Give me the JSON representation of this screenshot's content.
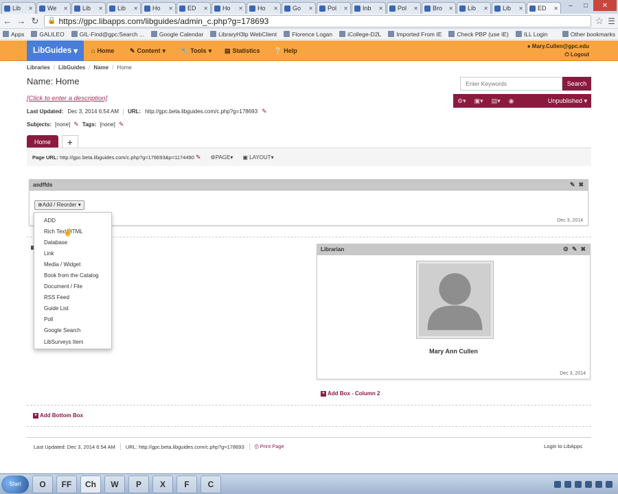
{
  "browser": {
    "tabs": [
      {
        "label": "Lib",
        "active": false
      },
      {
        "label": "We",
        "active": false
      },
      {
        "label": "Lib",
        "active": false
      },
      {
        "label": "Lib",
        "active": false
      },
      {
        "label": "Ho",
        "active": false
      },
      {
        "label": "ED",
        "active": false
      },
      {
        "label": "Ho",
        "active": false
      },
      {
        "label": "Ho",
        "active": false
      },
      {
        "label": "Go",
        "active": false
      },
      {
        "label": "Pol",
        "active": false
      },
      {
        "label": "Inb",
        "active": false
      },
      {
        "label": "Pol",
        "active": false
      },
      {
        "label": "Bro",
        "active": false
      },
      {
        "label": "Lib",
        "active": false
      },
      {
        "label": "Lib",
        "active": false
      },
      {
        "label": "ED",
        "active": true
      }
    ],
    "url": "https://gpc.libapps.com/libguides/admin_c.php?g=178693",
    "bookmarks": [
      "Apps",
      "GALILEO",
      "GIL-Find@gpc:Search ...",
      "Google Calendar",
      "LibraryH3lp WebClient",
      "Florence Logan",
      "iCollege-D2L",
      "Imported From IE",
      "Check PBP (use IE)",
      "ILL Login"
    ],
    "other_bookmarks": "Other bookmarks"
  },
  "libguides_nav": {
    "brand": "LibGuides",
    "items": [
      "Home",
      "Content",
      "Tools",
      "Statistics",
      "Help"
    ],
    "user_email": "Mary.Cullen@gpc.edu",
    "logout": "Logout"
  },
  "breadcrumb": [
    "Libraries",
    "LibGuides",
    "Name",
    "Home"
  ],
  "guide": {
    "title": "Name: Home",
    "description_prompt": "[Click to enter a description]",
    "last_updated_label": "Last Updated:",
    "last_updated": "Dec 3, 2014 6:54 AM",
    "url_label": "URL:",
    "url": "http://gpc.beta.libguides.com/c.php?g=178693",
    "subjects_label": "Subjects:",
    "subjects_value": "[none]",
    "tags_label": "Tags:",
    "tags_value": "[none]"
  },
  "search": {
    "placeholder": "Enter Keywords",
    "button": "Search"
  },
  "toolbar": {
    "unpublished": "Unpublished"
  },
  "page_tabs": {
    "home": "Home",
    "add": "+"
  },
  "page_url": {
    "label": "Page URL:",
    "value": "http://gpc.beta.libguides.com/c.php?g=178693&p=1174490",
    "page_btn": "PAGE",
    "layout_btn": "LAYOUT"
  },
  "box1": {
    "title": "asdffds",
    "add_reorder": "Add / Reorder",
    "date": "Dec 3, 2014"
  },
  "dropdown_items": [
    "ADD",
    "Rich Text/HTML",
    "Database",
    "Link",
    "Media / Widget",
    "Book from the Catalog",
    "Document / File",
    "RSS Feed",
    "Guide List",
    "Poll",
    "Google Search",
    "LibSurveys Item"
  ],
  "librarian_box": {
    "title": "Librarian",
    "name": "Mary Ann Cullen",
    "date": "Dec 3, 2014"
  },
  "add_box_col2": "Add Box - Column 2",
  "add_bottom_box": "Add Bottom Box",
  "footer": {
    "last_updated": "Last Updated: Dec 3, 2014 6:54 AM",
    "url": "URL: http://gpc.beta.libguides.com/c.php?g=178693",
    "print": "Print Page",
    "login": "Login to LibApps"
  },
  "taskbar": {
    "start": "Start",
    "apps": [
      "O",
      "FF",
      "Ch",
      "W",
      "P",
      "X",
      "F",
      "C"
    ]
  },
  "colors": {
    "maroon": "#8b1a3f",
    "orange": "#f7a541",
    "brand_blue": "#4a7dd6"
  }
}
